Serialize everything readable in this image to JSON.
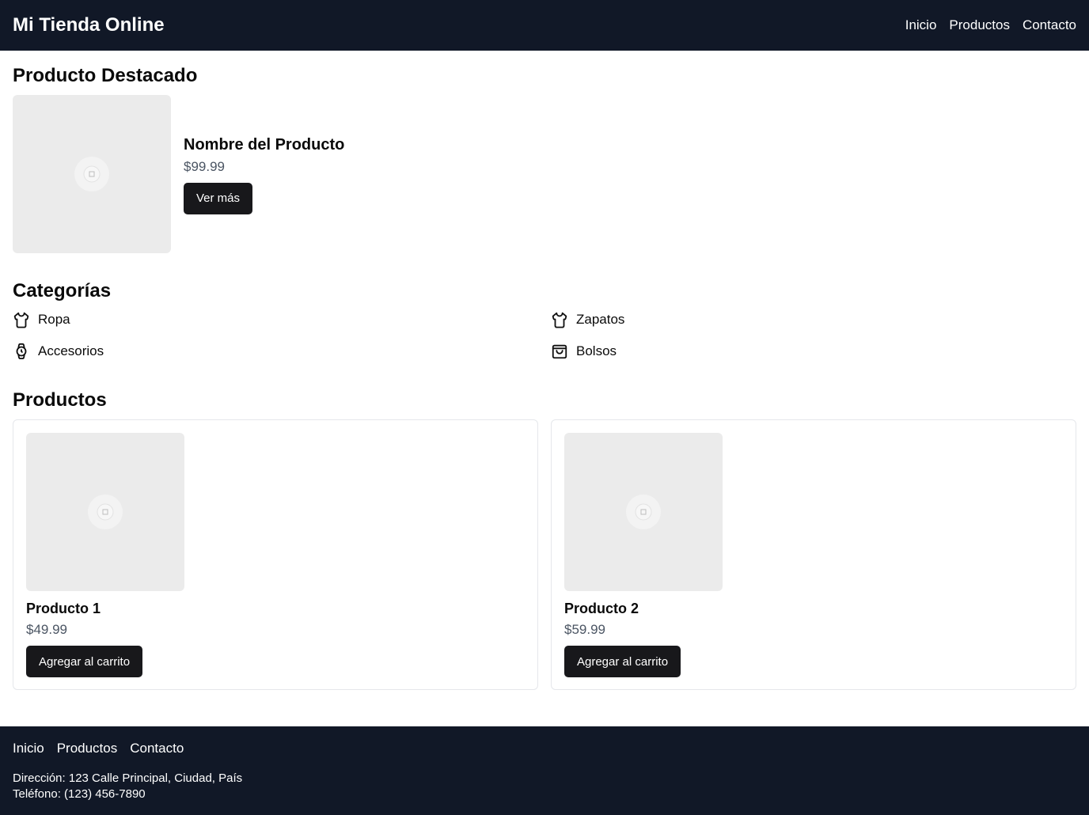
{
  "header": {
    "brand": "Mi Tienda Online",
    "nav": [
      "Inicio",
      "Productos",
      "Contacto"
    ]
  },
  "featured": {
    "title": "Producto Destacado",
    "name": "Nombre del Producto",
    "price": "$99.99",
    "button": "Ver más",
    "image_icon": "image-placeholder-icon"
  },
  "categories": {
    "title": "Categorías",
    "items": [
      {
        "label": "Ropa",
        "icon": "shirt-icon"
      },
      {
        "label": "Zapatos",
        "icon": "shirt-icon"
      },
      {
        "label": "Accesorios",
        "icon": "watch-icon"
      },
      {
        "label": "Bolsos",
        "icon": "shopping-bag-icon"
      }
    ]
  },
  "products": {
    "title": "Productos",
    "items": [
      {
        "name": "Producto 1",
        "price": "$49.99",
        "button": "Agregar al carrito"
      },
      {
        "name": "Producto 2",
        "price": "$59.99",
        "button": "Agregar al carrito"
      }
    ]
  },
  "footer": {
    "nav": [
      "Inicio",
      "Productos",
      "Contacto"
    ],
    "address": "Dirección: 123 Calle Principal, Ciudad, País",
    "phone": "Teléfono: (123) 456-7890"
  },
  "colors": {
    "header_bg": "#111827",
    "button_bg": "#18181b",
    "placeholder_bg": "#ebebeb"
  }
}
